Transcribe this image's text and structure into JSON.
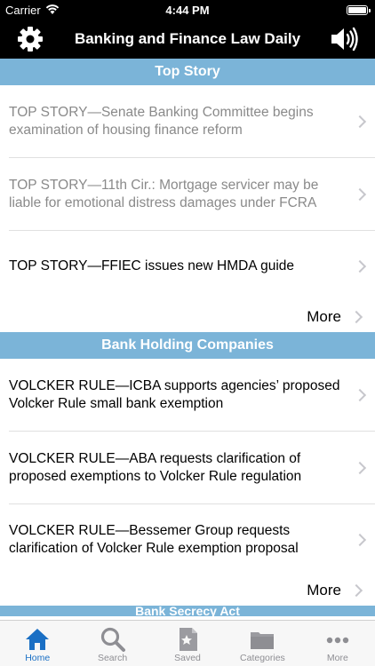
{
  "status": {
    "carrier": "Carrier",
    "time": "4:44 PM"
  },
  "nav": {
    "title": "Banking and Finance Law Daily",
    "settings_icon": "gear-icon",
    "audio_icon": "speaker-icon"
  },
  "colors": {
    "section_header": "#7bb4d8",
    "active_tab": "#1a6fc4",
    "read_text": "#8a8a8a"
  },
  "sections": [
    {
      "header": "Top Story",
      "items": [
        {
          "text": "TOP STORY—Senate Banking Committee begins examination of housing finance reform",
          "read": true
        },
        {
          "text": "TOP STORY—11th Cir.: Mortgage servicer may be liable for emotional distress damages under FCRA",
          "read": true
        },
        {
          "text": "TOP STORY—FFIEC issues new HMDA guide",
          "read": false
        }
      ],
      "more": "More"
    },
    {
      "header": "Bank Holding Companies",
      "items": [
        {
          "text": "VOLCKER RULE—ICBA supports agencies’ proposed Volcker Rule small bank exemption",
          "read": false
        },
        {
          "text": "VOLCKER RULE—ABA requests clarification of proposed exemptions to Volcker Rule regulation",
          "read": false
        },
        {
          "text": "VOLCKER RULE—Bessemer Group requests clarification of Volcker Rule exemption proposal",
          "read": false
        }
      ],
      "more": "More"
    }
  ],
  "next_section_header": "Bank Secrecy Act",
  "tabs": [
    {
      "label": "Home",
      "icon": "home-icon",
      "active": true
    },
    {
      "label": "Search",
      "icon": "search-icon",
      "active": false
    },
    {
      "label": "Saved",
      "icon": "saved-icon",
      "active": false
    },
    {
      "label": "Categories",
      "icon": "folder-icon",
      "active": false
    },
    {
      "label": "More",
      "icon": "more-icon",
      "active": false
    }
  ]
}
